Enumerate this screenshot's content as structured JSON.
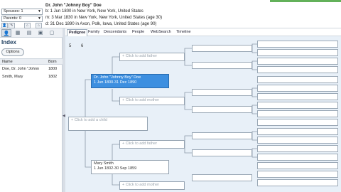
{
  "header": {
    "spouses_label": "Spouses: 1",
    "parents_label": "Parents: 0",
    "person_name": "Dr. John \"Johnny Boy\" Doe",
    "birth_line": "b: 1 Jun 1800 in New York, New York, United States",
    "marriage_line": "m: 3 Mar 1830 in New York, New York, United States (age 30)",
    "death_line": "d: 31 Dec 1890 in Axon, Polk, Iowa, United States (age 90)"
  },
  "left_pane": {
    "title": "Index",
    "options_label": "Options",
    "columns": [
      "Name",
      "Born"
    ],
    "rows": [
      {
        "name": "Doe, Dr. John \"Johnn",
        "born": "1800"
      },
      {
        "name": "Smith, Mary",
        "born": "1802"
      }
    ]
  },
  "tabs": [
    "Pedigree",
    "Family",
    "Descendants",
    "People",
    "WebSearch",
    "Timeline"
  ],
  "generation_numbers": [
    "5",
    "6"
  ],
  "people": {
    "root_father_prompt": "+ Click to add father",
    "root_mother_prompt": "+ Click to add mother",
    "child_prompt": "+ Click to add a child",
    "focus_name": "Dr. John \"Johnny Boy\" Doe",
    "focus_dates": "1 Jun 1800-31 Dec 1890",
    "spouse_name": "Mary Smith",
    "spouse_dates": "1 Jun 1802-30 Sep 1859",
    "spouse_father_prompt": "+ Click to add father",
    "spouse_mother_prompt": "+ Click to add mother"
  },
  "colors": {
    "selected": "#3d8fe0",
    "chart_bg": "#e8f0f8",
    "accent_green": "#63b15a"
  }
}
